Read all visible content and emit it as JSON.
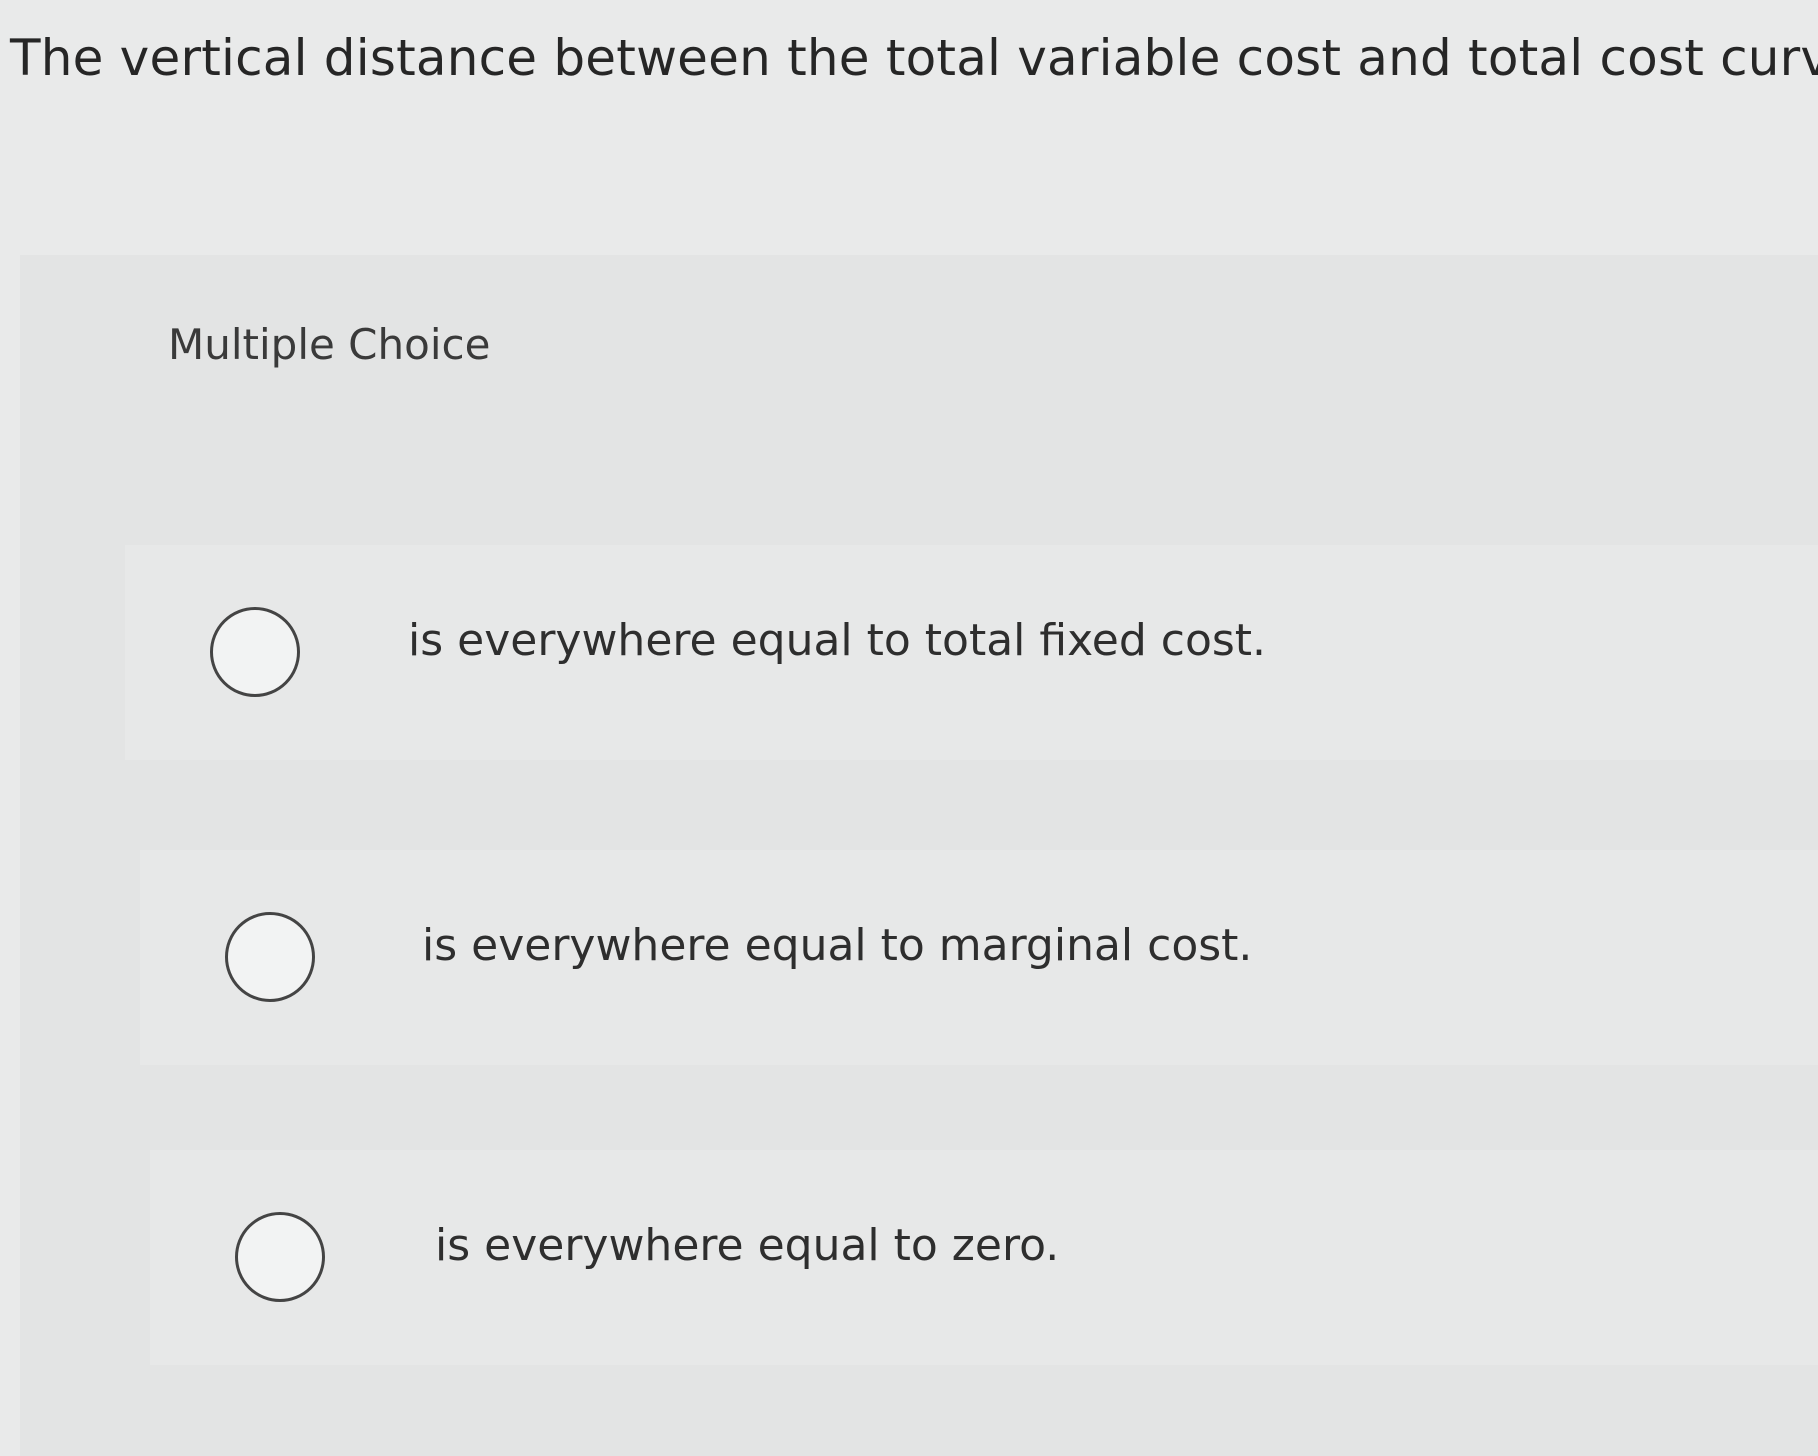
{
  "question": {
    "text": "The vertical distance between the total variable cost and total cost curves"
  },
  "multiple_choice": {
    "label": "Multiple Choice",
    "options": [
      {
        "text": "is everywhere equal to total fixed cost.",
        "selected": false
      },
      {
        "text": "is everywhere equal to marginal cost.",
        "selected": false
      },
      {
        "text": "is everywhere equal to zero.",
        "selected": false
      }
    ]
  }
}
